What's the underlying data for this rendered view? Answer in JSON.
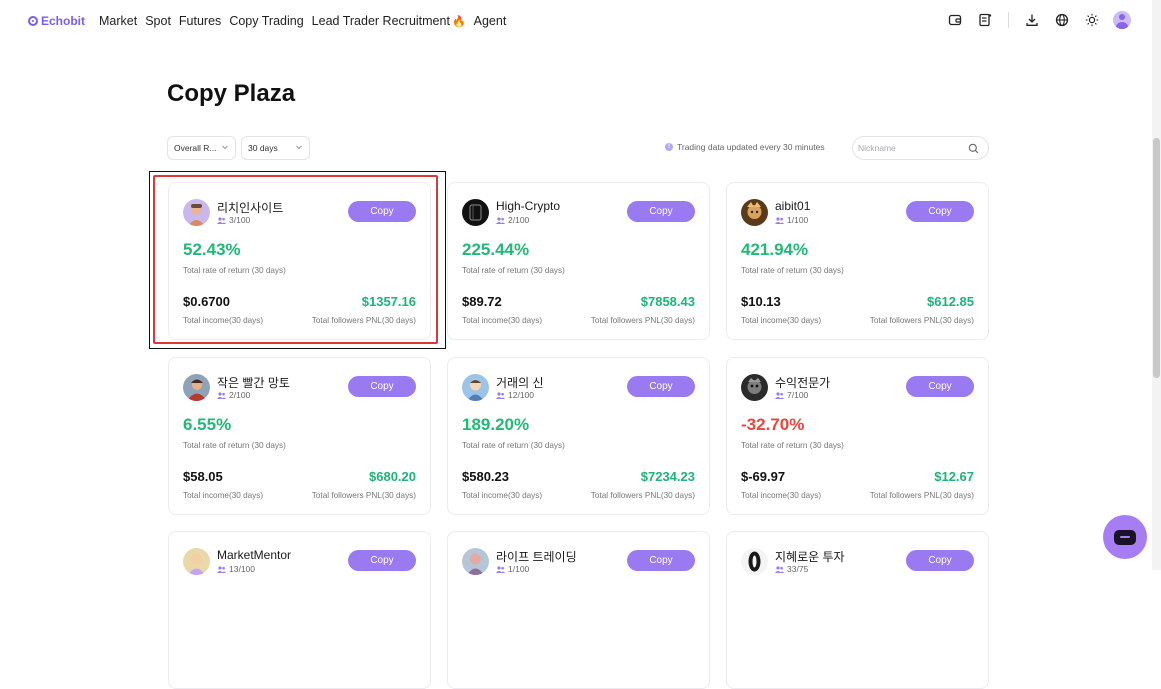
{
  "nav": {
    "logo": "Echobit",
    "items": [
      "Market",
      "Spot",
      "Futures",
      "Copy Trading",
      "Lead Trader Recruitment",
      "Agent"
    ],
    "icons": [
      "wallet-icon",
      "orders-icon",
      "download-icon",
      "globe-icon",
      "sun-icon",
      "user-avatar-icon"
    ]
  },
  "page": {
    "title": "Copy Plaza",
    "filter_rank": "Overall R...",
    "filter_period": "30 days",
    "update_note": "Trading data updated every 30 minutes",
    "search_placeholder": "Nickname"
  },
  "colors": {
    "accent": "#9a7af0",
    "positive": "#22b878",
    "negative": "#e8473e",
    "highlight": "#d93a35"
  },
  "traders": [
    {
      "name": "리치인사이트",
      "followers": "3/100",
      "copy_label": "Copy",
      "rate": "52.43%",
      "rate_label": "Total rate of return (30 days)",
      "income": "$0.6700",
      "income_label": "Total income(30 days)",
      "pnl": "$1357.16",
      "pnl_label": "Total followers PNL(30 days)",
      "rate_positive": true
    },
    {
      "name": "High-Crypto",
      "followers": "2/100",
      "copy_label": "Copy",
      "rate": "225.44%",
      "rate_label": "Total rate of return (30 days)",
      "income": "$89.72",
      "income_label": "Total income(30 days)",
      "pnl": "$7858.43",
      "pnl_label": "Total followers PNL(30 days)",
      "rate_positive": true
    },
    {
      "name": "aibit01",
      "followers": "1/100",
      "copy_label": "Copy",
      "rate": "421.94%",
      "rate_label": "Total rate of return (30 days)",
      "income": "$10.13",
      "income_label": "Total income(30 days)",
      "pnl": "$612.85",
      "pnl_label": "Total followers PNL(30 days)",
      "rate_positive": true
    },
    {
      "name": "작은 빨간 망토",
      "followers": "2/100",
      "copy_label": "Copy",
      "rate": "6.55%",
      "rate_label": "Total rate of return (30 days)",
      "income": "$58.05",
      "income_label": "Total income(30 days)",
      "pnl": "$680.20",
      "pnl_label": "Total followers PNL(30 days)",
      "rate_positive": true
    },
    {
      "name": "거래의 신",
      "followers": "12/100",
      "copy_label": "Copy",
      "rate": "189.20%",
      "rate_label": "Total rate of return (30 days)",
      "income": "$580.23",
      "income_label": "Total income(30 days)",
      "pnl": "$7234.23",
      "pnl_label": "Total followers PNL(30 days)",
      "rate_positive": true
    },
    {
      "name": "수익전문가",
      "followers": "7/100",
      "copy_label": "Copy",
      "rate": "-32.70%",
      "rate_label": "Total rate of return (30 days)",
      "income": "$-69.97",
      "income_label": "Total income(30 days)",
      "pnl": "$12.67",
      "pnl_label": "Total followers PNL(30 days)",
      "rate_positive": false
    },
    {
      "name": "MarketMentor",
      "followers": "13/100",
      "copy_label": "Copy"
    },
    {
      "name": "라이프 트레이딩",
      "followers": "1/100",
      "copy_label": "Copy"
    },
    {
      "name": "지혜로운 투자",
      "followers": "33/75",
      "copy_label": "Copy"
    }
  ]
}
